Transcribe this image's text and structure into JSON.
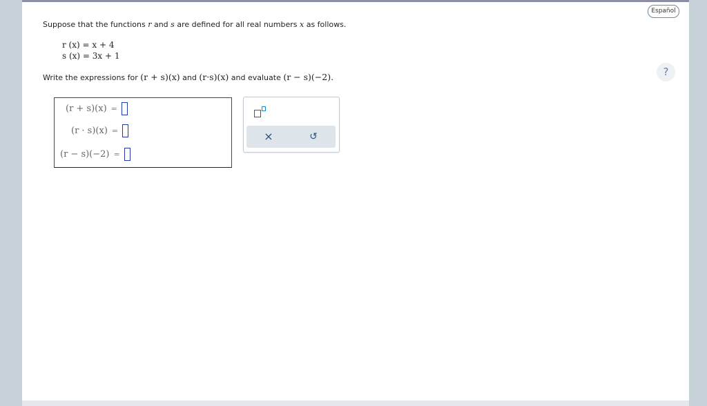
{
  "header": {
    "language_button": "Español",
    "help_label": "?"
  },
  "problem": {
    "intro_prefix": "Suppose that the functions",
    "intro_r": "r",
    "intro_and": "and",
    "intro_s": "s",
    "intro_mid": "are defined for all real numbers",
    "intro_x": "x",
    "intro_suffix": "as follows.",
    "definitions": [
      "r (x) = x + 4",
      "s (x) = 3x + 1"
    ],
    "instruction_prefix": "Write the expressions for",
    "instruction_expr1": "(r + s)(x)",
    "instruction_and": "and",
    "instruction_expr2": "(r·s)(x)",
    "instruction_mid": "and evaluate",
    "instruction_expr3": "(r − s)(−2)."
  },
  "answers": {
    "rows": [
      {
        "label": "(r + s)(x)",
        "equals": "=",
        "value": ""
      },
      {
        "label": "(r · s)(x)",
        "equals": "=",
        "value": ""
      },
      {
        "label": "(r − s)(−2)",
        "equals": "=",
        "value": ""
      }
    ]
  },
  "toolbar": {
    "exponent_icon": "superscript-icon",
    "clear_icon": "×",
    "undo_icon": "↺"
  }
}
